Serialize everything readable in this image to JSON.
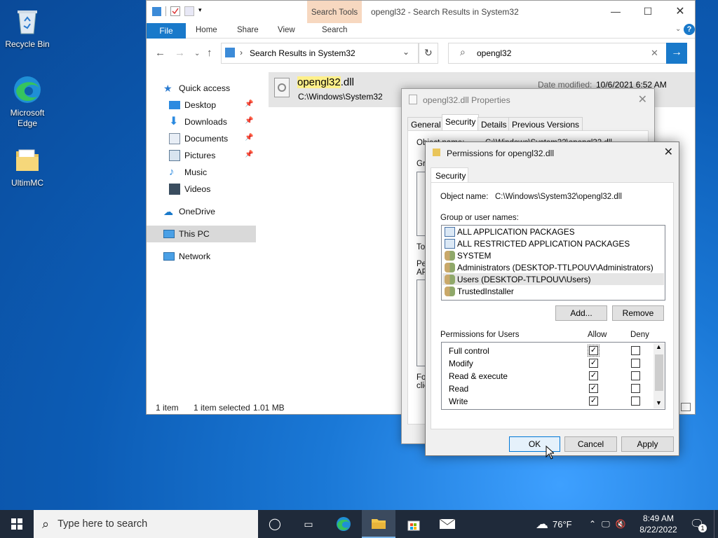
{
  "desktop": {
    "icons": [
      {
        "label": "Recycle Bin"
      },
      {
        "label": "Microsoft Edge"
      },
      {
        "label": "UltimMC"
      }
    ]
  },
  "explorer": {
    "title": "opengl32 - Search Results in System32",
    "contextual_tab": "Search Tools",
    "ribbon_tabs": [
      "File",
      "Home",
      "Share",
      "View",
      "Search"
    ],
    "address": "Search Results in System32",
    "search_value": "opengl32",
    "sidebar": {
      "quick_access": "Quick access",
      "items": [
        "Desktop",
        "Downloads",
        "Documents",
        "Pictures",
        "Music",
        "Videos"
      ],
      "onedrive": "OneDrive",
      "thispc": "This PC",
      "network": "Network"
    },
    "result": {
      "name_highlight": "opengl32",
      "name_ext": ".dll",
      "path": "C:\\Windows\\System32",
      "date_label": "Date modified:",
      "date_value": "10/6/2021 6:52 AM"
    },
    "status": {
      "count": "1 item",
      "selected": "1 item selected",
      "size": "1.01 MB"
    }
  },
  "properties": {
    "title": "opengl32.dll Properties",
    "tabs": [
      "General",
      "Security",
      "Details",
      "Previous Versions"
    ],
    "partial_labels": {
      "object": "Object name:",
      "object_value": "C:\\Windows\\System32\\opengl32.dll",
      "group": "Gro",
      "to": "To",
      "pe": "Pe",
      "ap": "AP",
      "fo": "Fo",
      "cli": "clic"
    }
  },
  "permissions": {
    "title": "Permissions for opengl32.dll",
    "tab": "Security",
    "object_label": "Object name:",
    "object_value": "C:\\Windows\\System32\\opengl32.dll",
    "group_label": "Group or user names:",
    "users": [
      "ALL APPLICATION PACKAGES",
      "ALL RESTRICTED APPLICATION PACKAGES",
      "SYSTEM",
      "Administrators (DESKTOP-TTLPOUV\\Administrators)",
      "Users (DESKTOP-TTLPOUV\\Users)",
      "TrustedInstaller"
    ],
    "selected_user_index": 4,
    "add_button": "Add...",
    "remove_button": "Remove",
    "perm_for_label": "Permissions for Users",
    "allow_label": "Allow",
    "deny_label": "Deny",
    "perm_rows": [
      {
        "name": "Full control",
        "allow": true,
        "deny": false
      },
      {
        "name": "Modify",
        "allow": true,
        "deny": false
      },
      {
        "name": "Read & execute",
        "allow": true,
        "deny": false
      },
      {
        "name": "Read",
        "allow": true,
        "deny": false
      },
      {
        "name": "Write",
        "allow": true,
        "deny": false
      }
    ],
    "ok_button": "OK",
    "cancel_button": "Cancel",
    "apply_button": "Apply"
  },
  "taskbar": {
    "search_placeholder": "Type here to search",
    "weather": "76°F",
    "time": "8:49 AM",
    "date": "8/22/2022",
    "notif_count": "1"
  }
}
